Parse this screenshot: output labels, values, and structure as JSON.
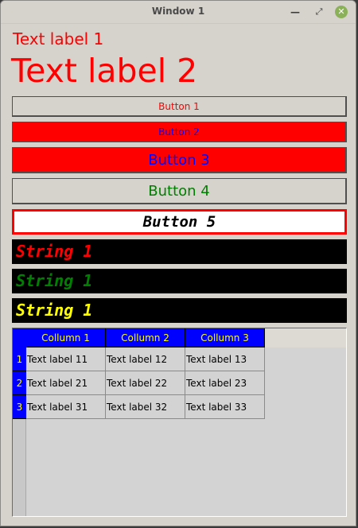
{
  "window": {
    "title": "Window 1",
    "controls": {
      "minimize": "minimize-icon",
      "maximize": "restore-icon",
      "close": "close-icon"
    }
  },
  "labels": {
    "label1": "Text label 1",
    "label2": "Text label 2"
  },
  "buttons": {
    "button1": "Button 1",
    "button2": "Button 2",
    "button3": "Button 3",
    "button4": "Button 4",
    "button5": "Button 5"
  },
  "strings": {
    "string1_red": "String 1",
    "string1_green": "String 1",
    "string1_yellow": "String 1"
  },
  "colors": {
    "red": "#ff0000",
    "blue": "#0000ff",
    "green": "#008000",
    "yellow": "#ffff00",
    "black": "#000000",
    "white": "#ffffff",
    "window_bg": "#d6d2cc"
  },
  "table": {
    "columns": [
      "Collumn 1",
      "Collumn 2",
      "Collumn 3"
    ],
    "rows": [
      {
        "header": "1",
        "cells": [
          "Text label 11",
          "Text label 12",
          "Text label 13"
        ]
      },
      {
        "header": "2",
        "cells": [
          "Text label 21",
          "Text label 22",
          "Text label 23"
        ]
      },
      {
        "header": "3",
        "cells": [
          "Text label 31",
          "Text label 32",
          "Text label 33"
        ]
      }
    ]
  }
}
